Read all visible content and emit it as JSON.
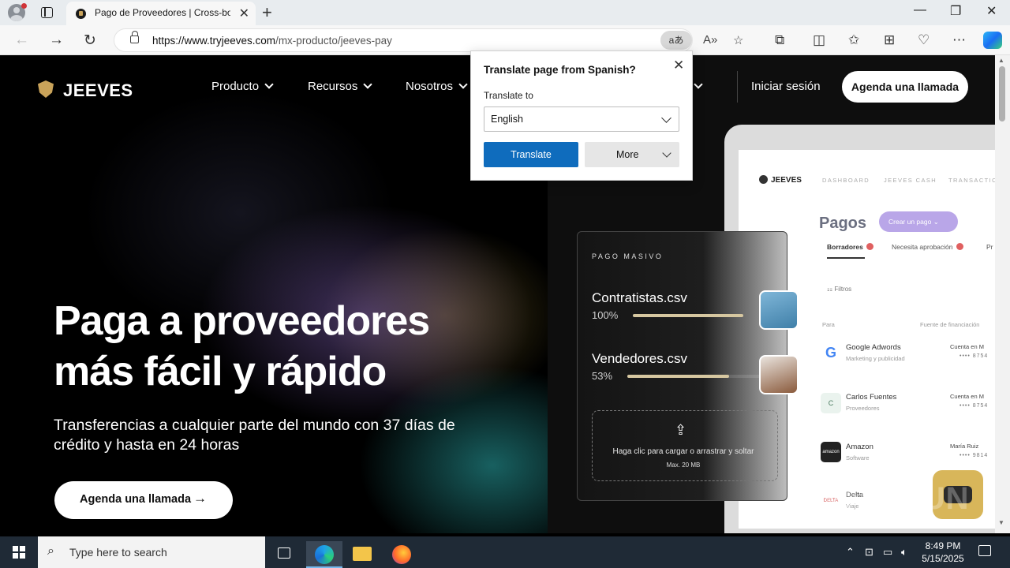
{
  "browser": {
    "tab_title": "Pago de Proveedores | Cross-bor",
    "url_host": "https://www.tryjeeves.com",
    "url_path": "/mx-producto/jeeves-pay",
    "translate_glyph": "aあ",
    "read_aloud_glyph": "A»"
  },
  "site": {
    "logo_text": "JEEVES",
    "nav": [
      "Producto",
      "Recursos",
      "Nosotros"
    ],
    "login": "Iniciar sesión",
    "cta_top": "Agenda una llamada",
    "hero_title_1": "Paga a proveedores",
    "hero_title_2": "más fácil y rápido",
    "hero_sub": "Transferencias a cualquier parte del mundo con 37 días de crédito y hasta en 24 horas",
    "hero_cta": "Agenda una llamada"
  },
  "bulk_card": {
    "label": "PAGO MASIVO",
    "files": [
      {
        "name": "Contratistas.csv",
        "pct": "100%",
        "progress": 1.0
      },
      {
        "name": "Vendedores.csv",
        "pct": "53%",
        "progress": 0.53
      }
    ],
    "upload_text": "Haga clic para cargar o arrastrar y soltar",
    "upload_max": "Max. 20 MB"
  },
  "dashboard": {
    "logo": "JEEVES",
    "nav": [
      "DASHBOARD",
      "JEEVES CASH",
      "TRANSACTION"
    ],
    "title": "Pagos",
    "create_btn": "Crear un pago",
    "tabs": [
      "Borradores",
      "Necesita aprobación",
      "Pr"
    ],
    "filters": "Filtros",
    "col_para": "Para",
    "col_fuente": "Fuente de financiación",
    "rows": [
      {
        "initial": "G",
        "name": "Google Adwords",
        "sub": "Marketing y publicidad",
        "acct": "Cuenta en M",
        "num": "•••• 8754"
      },
      {
        "initial": "C",
        "name": "Carlos Fuentes",
        "sub": "Proveedores",
        "acct": "Cuenta en M",
        "num": "•••• 8754"
      },
      {
        "initial": "amazon",
        "name": "Amazon",
        "sub": "Software",
        "acct": "María Ruiz",
        "num": "•••• 9814"
      },
      {
        "initial": "DELTA",
        "name": "Delta",
        "sub": "Viaje",
        "acct": "",
        "num": ""
      }
    ]
  },
  "translate_popup": {
    "title": "Translate page from Spanish?",
    "label": "Translate to",
    "language": "English",
    "translate_btn": "Translate",
    "more_btn": "More"
  },
  "watermark": "ANY RUN",
  "taskbar": {
    "search_placeholder": "Type here to search",
    "time": "8:49 PM",
    "date": "5/15/2025"
  },
  "colors": {
    "accent_blue": "#0f6cbd",
    "brand_gold": "#c9a35a",
    "dashboard_purple": "#b9a6e8"
  }
}
